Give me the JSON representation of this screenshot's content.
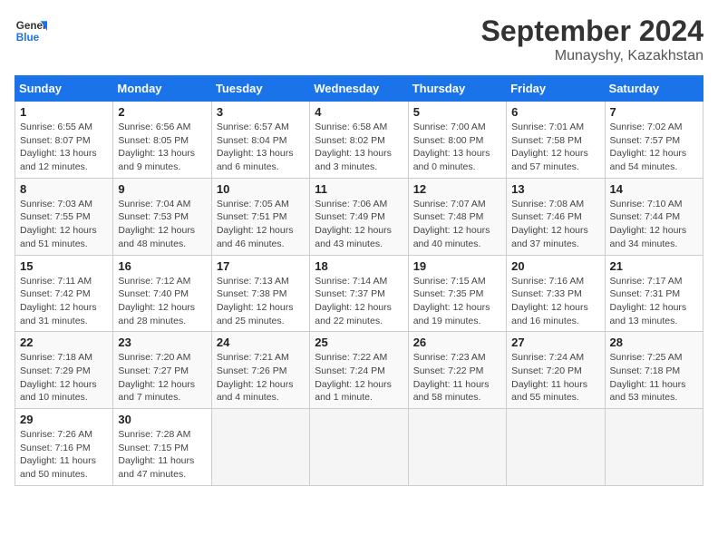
{
  "header": {
    "logo_line1": "General",
    "logo_line2": "Blue",
    "month": "September 2024",
    "location": "Munayshy, Kazakhstan"
  },
  "weekdays": [
    "Sunday",
    "Monday",
    "Tuesday",
    "Wednesday",
    "Thursday",
    "Friday",
    "Saturday"
  ],
  "weeks": [
    [
      {
        "day": "1",
        "detail": "Sunrise: 6:55 AM\nSunset: 8:07 PM\nDaylight: 13 hours\nand 12 minutes."
      },
      {
        "day": "2",
        "detail": "Sunrise: 6:56 AM\nSunset: 8:05 PM\nDaylight: 13 hours\nand 9 minutes."
      },
      {
        "day": "3",
        "detail": "Sunrise: 6:57 AM\nSunset: 8:04 PM\nDaylight: 13 hours\nand 6 minutes."
      },
      {
        "day": "4",
        "detail": "Sunrise: 6:58 AM\nSunset: 8:02 PM\nDaylight: 13 hours\nand 3 minutes."
      },
      {
        "day": "5",
        "detail": "Sunrise: 7:00 AM\nSunset: 8:00 PM\nDaylight: 13 hours\nand 0 minutes."
      },
      {
        "day": "6",
        "detail": "Sunrise: 7:01 AM\nSunset: 7:58 PM\nDaylight: 12 hours\nand 57 minutes."
      },
      {
        "day": "7",
        "detail": "Sunrise: 7:02 AM\nSunset: 7:57 PM\nDaylight: 12 hours\nand 54 minutes."
      }
    ],
    [
      {
        "day": "8",
        "detail": "Sunrise: 7:03 AM\nSunset: 7:55 PM\nDaylight: 12 hours\nand 51 minutes."
      },
      {
        "day": "9",
        "detail": "Sunrise: 7:04 AM\nSunset: 7:53 PM\nDaylight: 12 hours\nand 48 minutes."
      },
      {
        "day": "10",
        "detail": "Sunrise: 7:05 AM\nSunset: 7:51 PM\nDaylight: 12 hours\nand 46 minutes."
      },
      {
        "day": "11",
        "detail": "Sunrise: 7:06 AM\nSunset: 7:49 PM\nDaylight: 12 hours\nand 43 minutes."
      },
      {
        "day": "12",
        "detail": "Sunrise: 7:07 AM\nSunset: 7:48 PM\nDaylight: 12 hours\nand 40 minutes."
      },
      {
        "day": "13",
        "detail": "Sunrise: 7:08 AM\nSunset: 7:46 PM\nDaylight: 12 hours\nand 37 minutes."
      },
      {
        "day": "14",
        "detail": "Sunrise: 7:10 AM\nSunset: 7:44 PM\nDaylight: 12 hours\nand 34 minutes."
      }
    ],
    [
      {
        "day": "15",
        "detail": "Sunrise: 7:11 AM\nSunset: 7:42 PM\nDaylight: 12 hours\nand 31 minutes."
      },
      {
        "day": "16",
        "detail": "Sunrise: 7:12 AM\nSunset: 7:40 PM\nDaylight: 12 hours\nand 28 minutes."
      },
      {
        "day": "17",
        "detail": "Sunrise: 7:13 AM\nSunset: 7:38 PM\nDaylight: 12 hours\nand 25 minutes."
      },
      {
        "day": "18",
        "detail": "Sunrise: 7:14 AM\nSunset: 7:37 PM\nDaylight: 12 hours\nand 22 minutes."
      },
      {
        "day": "19",
        "detail": "Sunrise: 7:15 AM\nSunset: 7:35 PM\nDaylight: 12 hours\nand 19 minutes."
      },
      {
        "day": "20",
        "detail": "Sunrise: 7:16 AM\nSunset: 7:33 PM\nDaylight: 12 hours\nand 16 minutes."
      },
      {
        "day": "21",
        "detail": "Sunrise: 7:17 AM\nSunset: 7:31 PM\nDaylight: 12 hours\nand 13 minutes."
      }
    ],
    [
      {
        "day": "22",
        "detail": "Sunrise: 7:18 AM\nSunset: 7:29 PM\nDaylight: 12 hours\nand 10 minutes."
      },
      {
        "day": "23",
        "detail": "Sunrise: 7:20 AM\nSunset: 7:27 PM\nDaylight: 12 hours\nand 7 minutes."
      },
      {
        "day": "24",
        "detail": "Sunrise: 7:21 AM\nSunset: 7:26 PM\nDaylight: 12 hours\nand 4 minutes."
      },
      {
        "day": "25",
        "detail": "Sunrise: 7:22 AM\nSunset: 7:24 PM\nDaylight: 12 hours\nand 1 minute."
      },
      {
        "day": "26",
        "detail": "Sunrise: 7:23 AM\nSunset: 7:22 PM\nDaylight: 11 hours\nand 58 minutes."
      },
      {
        "day": "27",
        "detail": "Sunrise: 7:24 AM\nSunset: 7:20 PM\nDaylight: 11 hours\nand 55 minutes."
      },
      {
        "day": "28",
        "detail": "Sunrise: 7:25 AM\nSunset: 7:18 PM\nDaylight: 11 hours\nand 53 minutes."
      }
    ],
    [
      {
        "day": "29",
        "detail": "Sunrise: 7:26 AM\nSunset: 7:16 PM\nDaylight: 11 hours\nand 50 minutes."
      },
      {
        "day": "30",
        "detail": "Sunrise: 7:28 AM\nSunset: 7:15 PM\nDaylight: 11 hours\nand 47 minutes."
      },
      null,
      null,
      null,
      null,
      null
    ]
  ]
}
